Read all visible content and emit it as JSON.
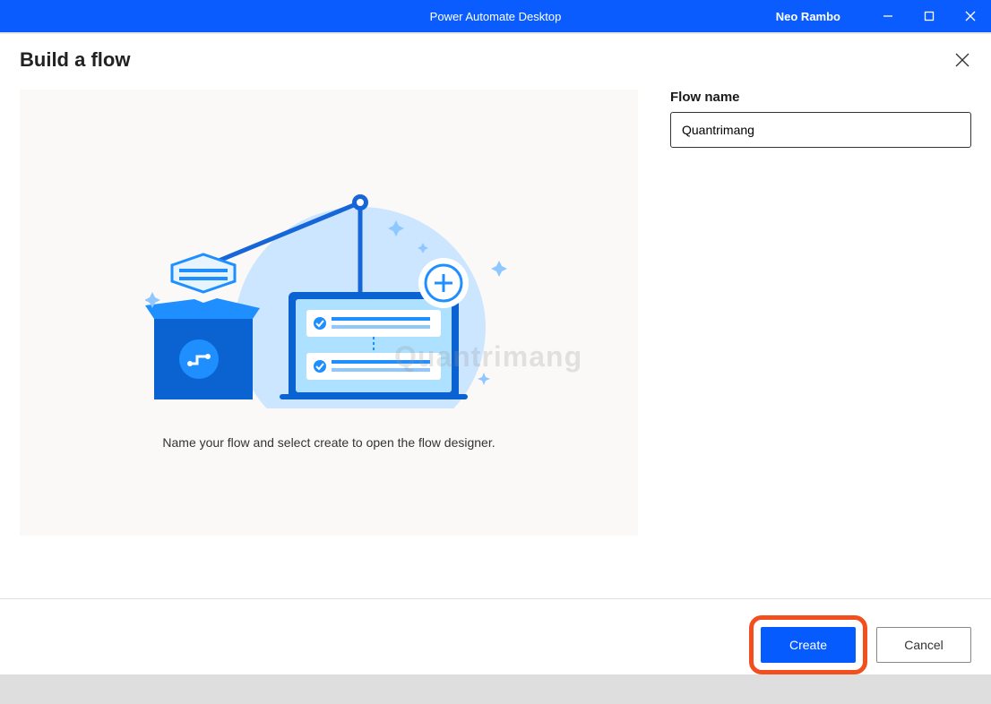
{
  "titlebar": {
    "app_name": "Power Automate Desktop",
    "user_name": "Neo Rambo"
  },
  "dialog": {
    "title": "Build a flow",
    "preview_hint": "Name your flow and select create to open the flow designer.",
    "flowname_label": "Flow name",
    "flowname_value": "Quantrimang",
    "create_label": "Create",
    "cancel_label": "Cancel"
  },
  "watermark": "Quantrimang"
}
